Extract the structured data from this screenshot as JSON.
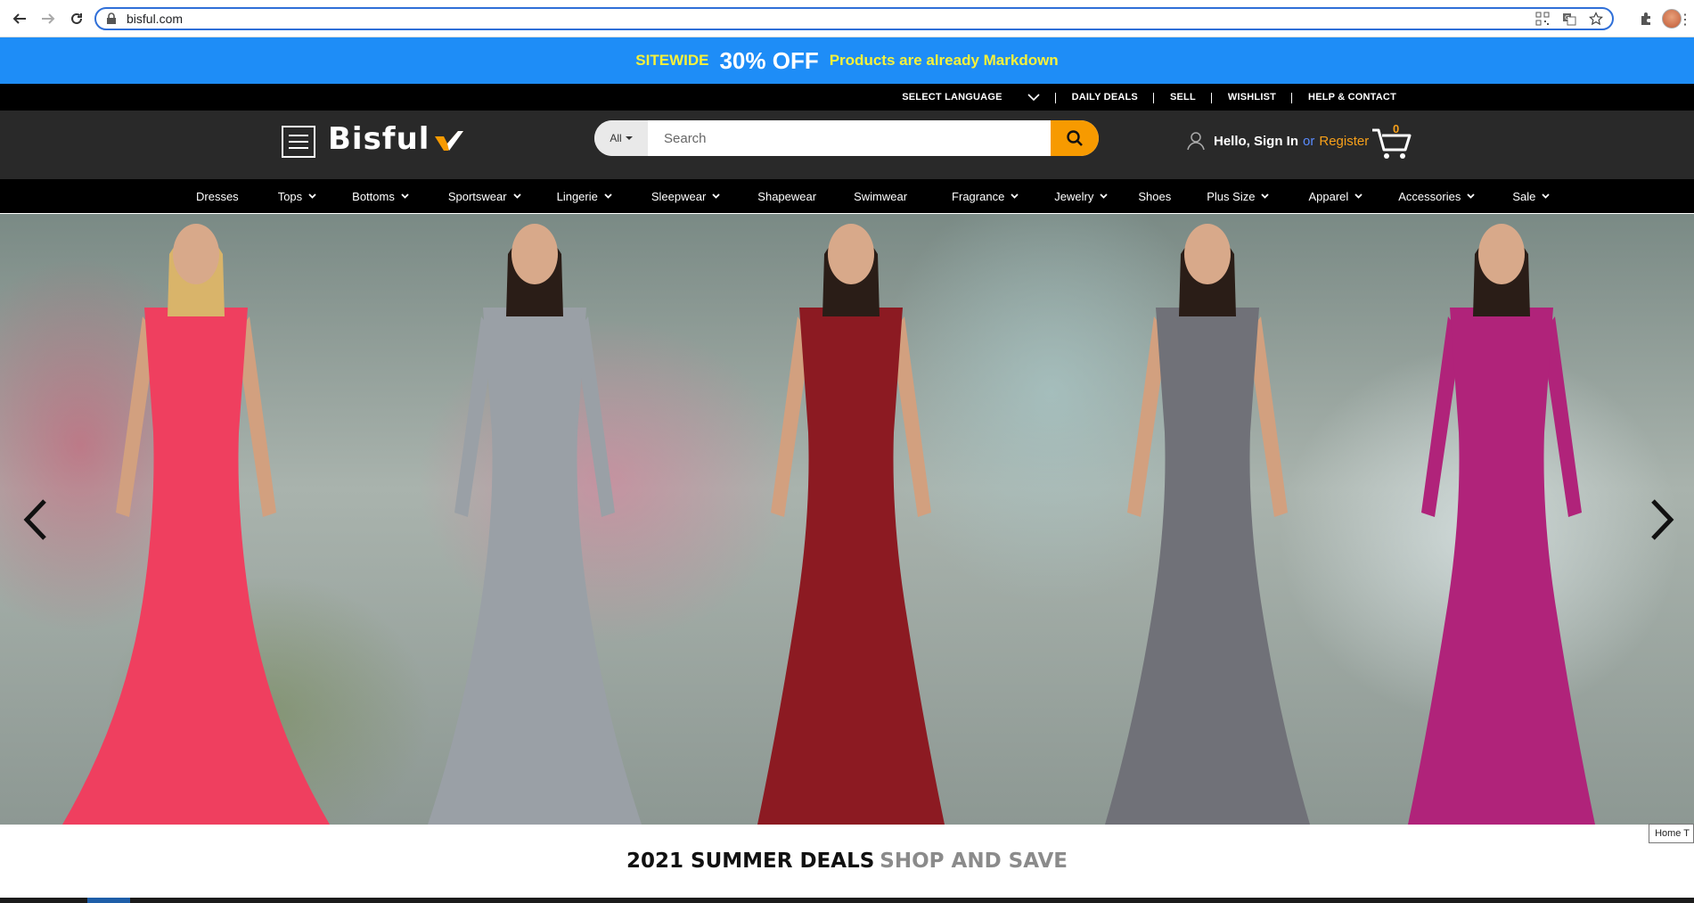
{
  "browser": {
    "url": "bisful.com"
  },
  "promo": {
    "left": "SITEWIDE",
    "center": "30% OFF",
    "right": "Products are already Markdown"
  },
  "utility": {
    "language": "SELECT LANGUAGE",
    "links": [
      "DAILY DEALS",
      "SELL",
      "WISHLIST",
      "HELP & CONTACT"
    ]
  },
  "header": {
    "logo": "Bisful",
    "search": {
      "category": "All",
      "placeholder": "Search"
    },
    "account": {
      "hello": "Hello, Sign In",
      "or": "or",
      "register": "Register"
    },
    "cart_count": "0"
  },
  "categories": [
    {
      "label": "Dresses",
      "dropdown": false
    },
    {
      "label": "Tops",
      "dropdown": true
    },
    {
      "label": "Bottoms",
      "dropdown": true
    },
    {
      "label": "Sportswear",
      "dropdown": true
    },
    {
      "label": "Lingerie",
      "dropdown": true
    },
    {
      "label": "Sleepwear",
      "dropdown": true
    },
    {
      "label": "Shapewear",
      "dropdown": false
    },
    {
      "label": "Swimwear",
      "dropdown": false
    },
    {
      "label": "Fragrance",
      "dropdown": true
    },
    {
      "label": "Jewelry",
      "dropdown": true
    },
    {
      "label": "Shoes",
      "dropdown": false
    },
    {
      "label": "Plus Size",
      "dropdown": true
    },
    {
      "label": "Apparel",
      "dropdown": true
    },
    {
      "label": "Accessories",
      "dropdown": true
    },
    {
      "label": "Sale",
      "dropdown": true
    }
  ],
  "hero": {
    "models": [
      {
        "dress_color": "#ef3f5f"
      },
      {
        "dress_color": "#9aa0a6"
      },
      {
        "dress_color": "#8c1a22"
      },
      {
        "dress_color": "#707178"
      },
      {
        "dress_color": "#b0237a"
      }
    ]
  },
  "deals": {
    "bold": "2021 SUMMER DEALS",
    "light": "SHOP AND SAVE"
  },
  "tooltip": "Home T",
  "colors": {
    "promo_bg": "#1e8df7",
    "promo_yellow": "#f7f13a",
    "header_bg": "#292929",
    "search_btn": "#f79a00",
    "register": "#f7a01a",
    "or": "#5a8cff"
  }
}
